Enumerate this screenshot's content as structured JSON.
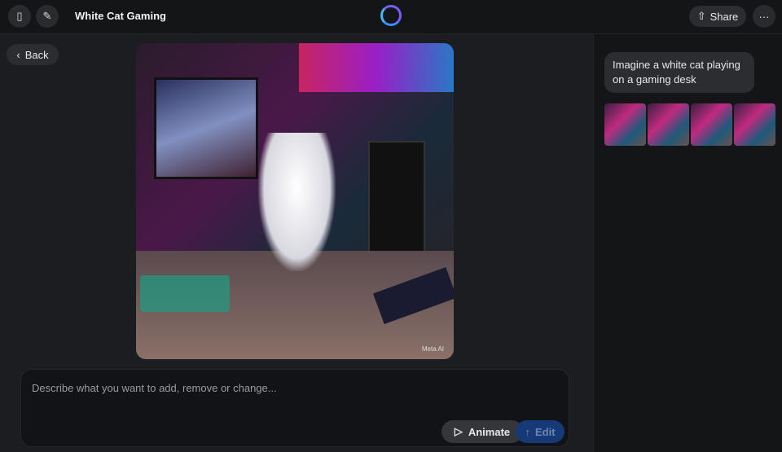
{
  "header": {
    "title": "White Cat Gaming",
    "share_label": "Share",
    "more_label": "···"
  },
  "nav": {
    "back_label": "Back"
  },
  "image": {
    "watermark": "Meta AI"
  },
  "composer": {
    "placeholder": "Describe what you want to add, remove or change...",
    "animate_label": "Animate",
    "edit_label": "Edit"
  },
  "sidebar": {
    "prompt": "Imagine a white cat playing on a gaming desk",
    "thumbnail_count": 4
  }
}
